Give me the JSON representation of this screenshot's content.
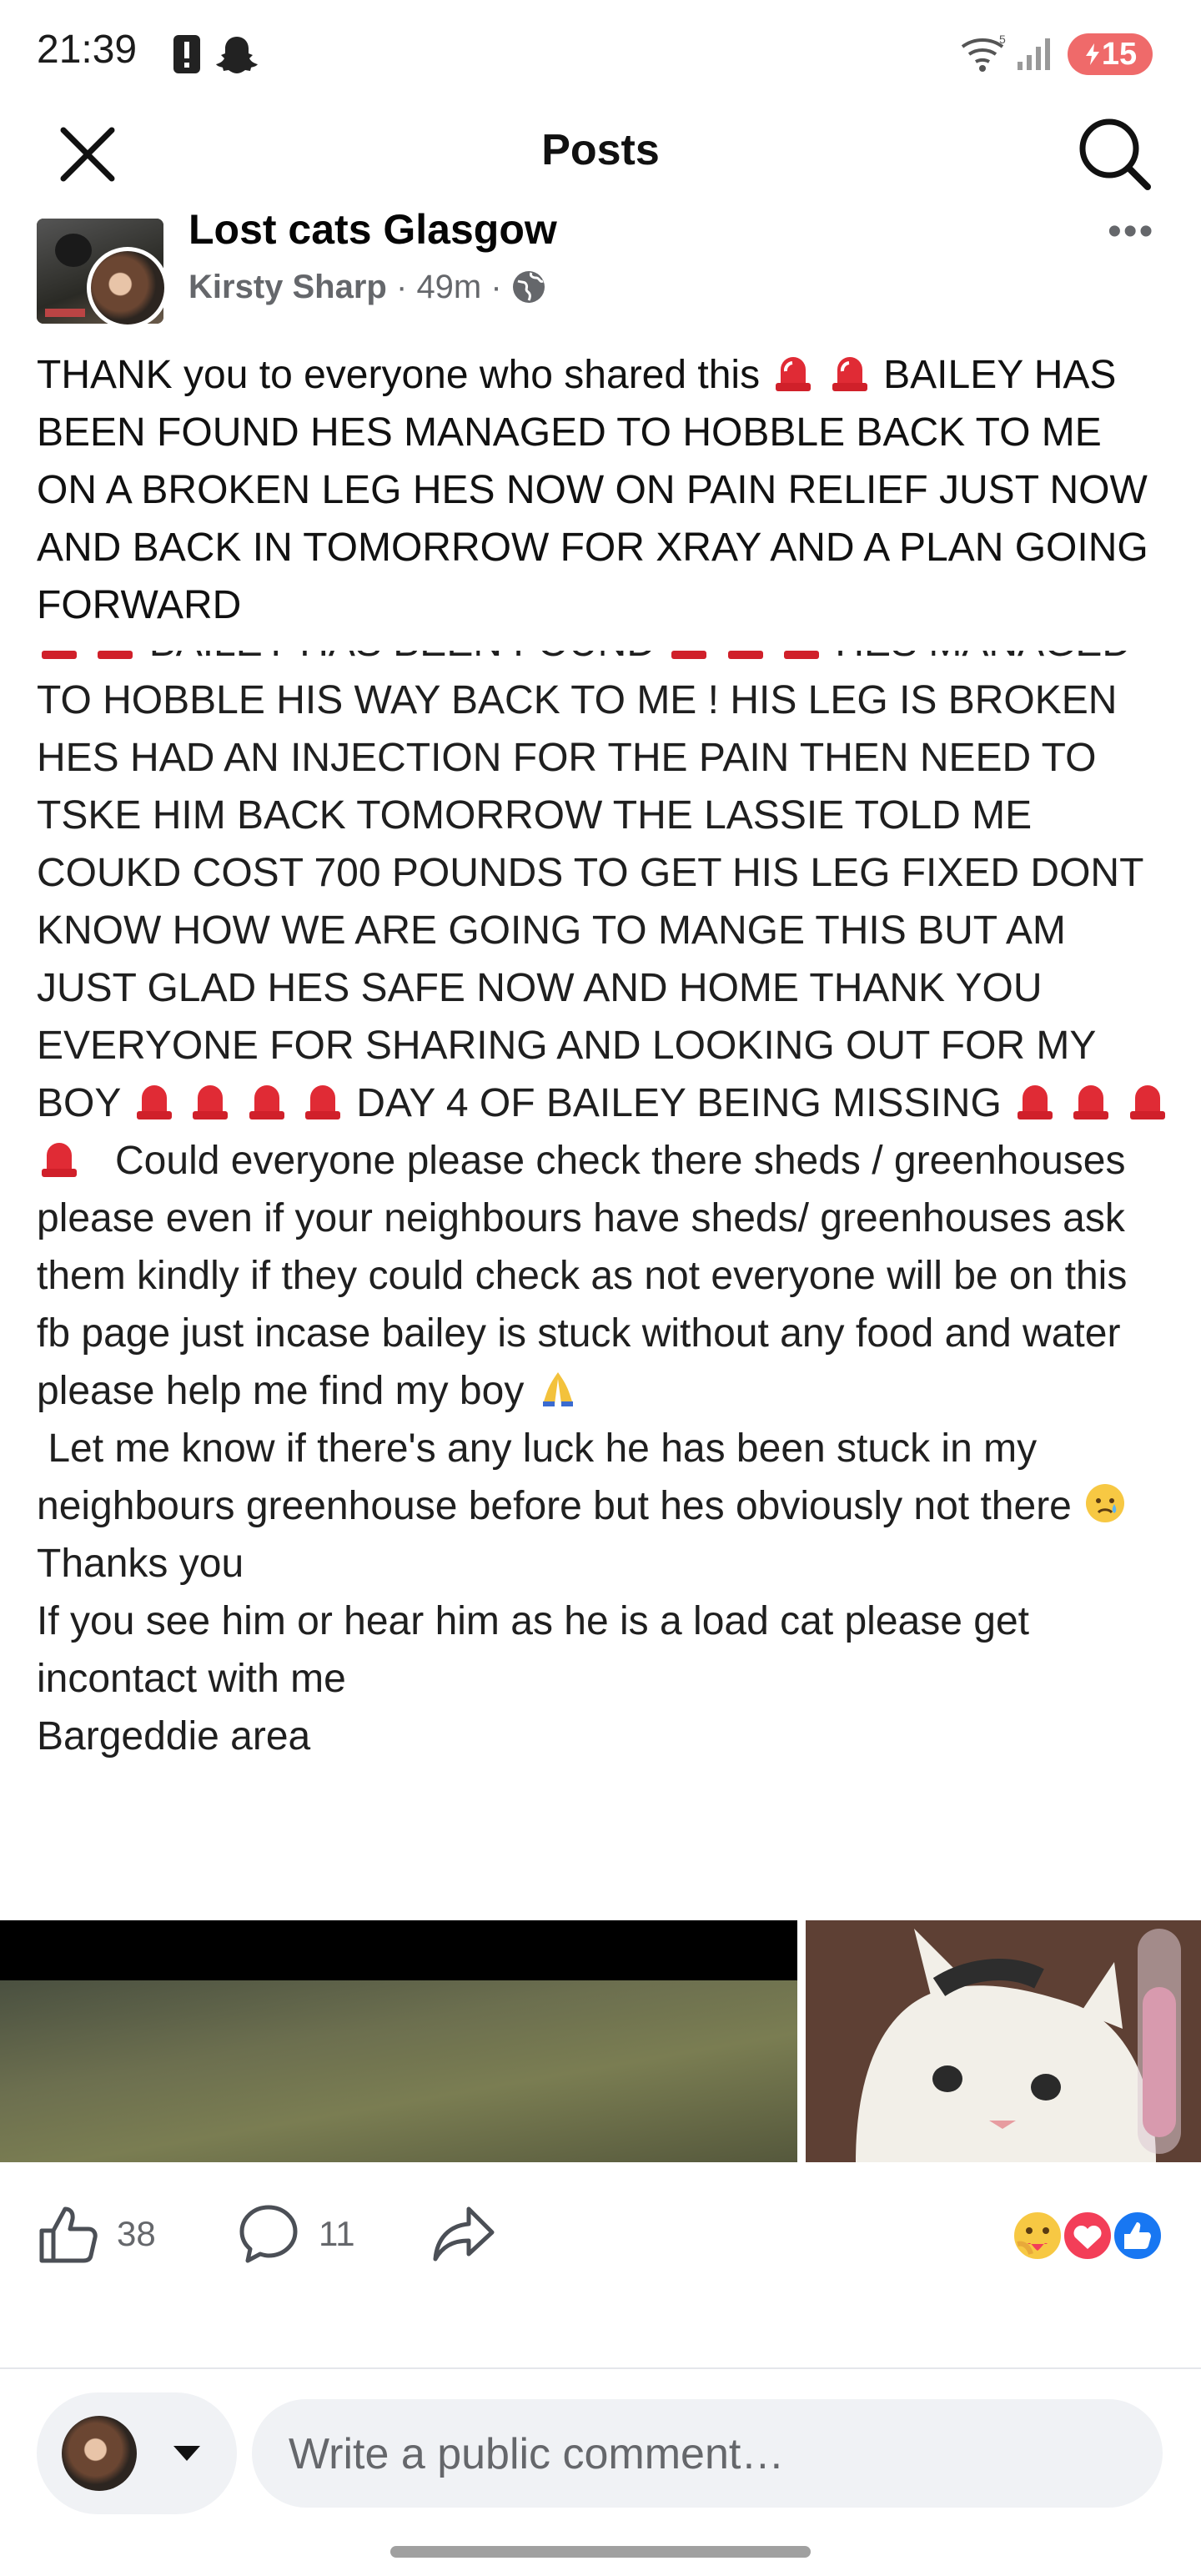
{
  "status_bar": {
    "time": "21:39",
    "battery": "15",
    "icons": [
      "alert-icon",
      "snapchat-icon",
      "wifi-icon",
      "signal-icon"
    ]
  },
  "header": {
    "title": "Posts",
    "close_icon": "close-icon",
    "search_icon": "search-icon"
  },
  "post": {
    "group": "Lost cats Glasgow",
    "author": "Kirsty Sharp",
    "time": "49m",
    "separator": "·",
    "privacy_icon": "globe-icon",
    "more": "•••",
    "text_1": "THANK you to everyone who shared this",
    "text_2": "BAILEY HAS BEEN FOUND HES MANAGED TO HOBBLE BACK TO ME ON A BROKEN LEG HES NOW ON PAIN RELIEF JUST NOW AND BACK IN TOMORROW FOR XRAY AND A PLAN GOING FORWARD",
    "shared_1": "BAILEY HAS BEEN FOUND",
    "shared_2": "HES MANAGED TO HOBBLE HIS WAY BACK TO ME ! HIS LEG IS BROKEN HES HAD AN INJECTION FOR THE PAIN THEN NEED TO TSKE HIM BACK TOMORROW THE LASSIE TOLD ME COUKD COST 700 POUNDS TO GET HIS LEG FIXED DONT KNOW HOW WE ARE GOING TO MANGE THIS BUT AM JUST GLAD HES SAFE NOW AND HOME THANK YOU EVERYONE FOR SHARING AND LOOKING OUT FOR MY BOY",
    "shared_3": "DAY 4 OF BAILEY BEING MISSING",
    "shared_4": "Could everyone please check there sheds / greenhouses please even if your neighbours have sheds/ greenhouses ask them kindly if they could check as not everyone will be on this fb page just incase bailey is  stuck without any food and water please help me find my boy",
    "shared_5": "Let me know if there's any luck he has been stuck in my neighbours greenhouse before but hes obviously not there",
    "shared_6": "Thanks you",
    "shared_7": "If you see him or hear him as he is a load cat please get incontact with me",
    "shared_8": "Bargeddie area",
    "emoji_names": [
      "siren-emoji",
      "folded-hands-emoji",
      "crying-face-emoji"
    ]
  },
  "actions": {
    "likes": "38",
    "comments": "11",
    "like_icon": "thumbs-up-icon",
    "comment_icon": "comment-icon",
    "share_icon": "share-icon",
    "reactions": [
      "care-reaction",
      "love-reaction",
      "like-reaction"
    ]
  },
  "comment": {
    "placeholder": "Write a public comment…"
  },
  "colors": {
    "meta": "#65676b",
    "battery": "#ef6a6a",
    "like_blue": "#1877f2",
    "love_red": "#f33e58",
    "siren_red": "#d0202a"
  }
}
